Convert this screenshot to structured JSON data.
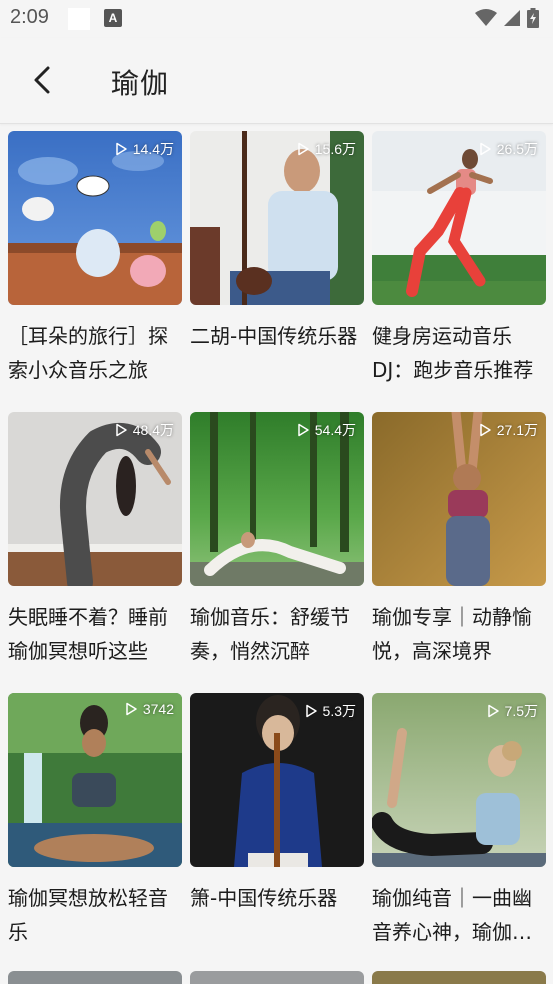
{
  "status_bar": {
    "time": "2:09",
    "notif_icon": "A"
  },
  "header": {
    "title": "瑜伽"
  },
  "cards": [
    {
      "title": "［耳朵的旅行］探索小众音乐之旅",
      "plays": "14.4万"
    },
    {
      "title": "二胡-中国传统乐器",
      "plays": "15.6万"
    },
    {
      "title": "健身房运动音乐DJ：跑步音乐推荐",
      "plays": "26.5万"
    },
    {
      "title": "失眠睡不着？睡前瑜伽冥想听这些",
      "plays": "48.4万"
    },
    {
      "title": "瑜伽音乐：舒缓节奏，悄然沉醉",
      "plays": "54.4万"
    },
    {
      "title": "瑜伽专享｜动静愉悦，高深境界",
      "plays": "27.1万"
    },
    {
      "title": "瑜伽冥想放松轻音乐",
      "plays": "3742"
    },
    {
      "title": "箫-中国传统乐器",
      "plays": "5.3万"
    },
    {
      "title": "瑜伽纯音｜一曲幽音养心神，瑜伽冥想",
      "plays": "7.5万"
    }
  ]
}
